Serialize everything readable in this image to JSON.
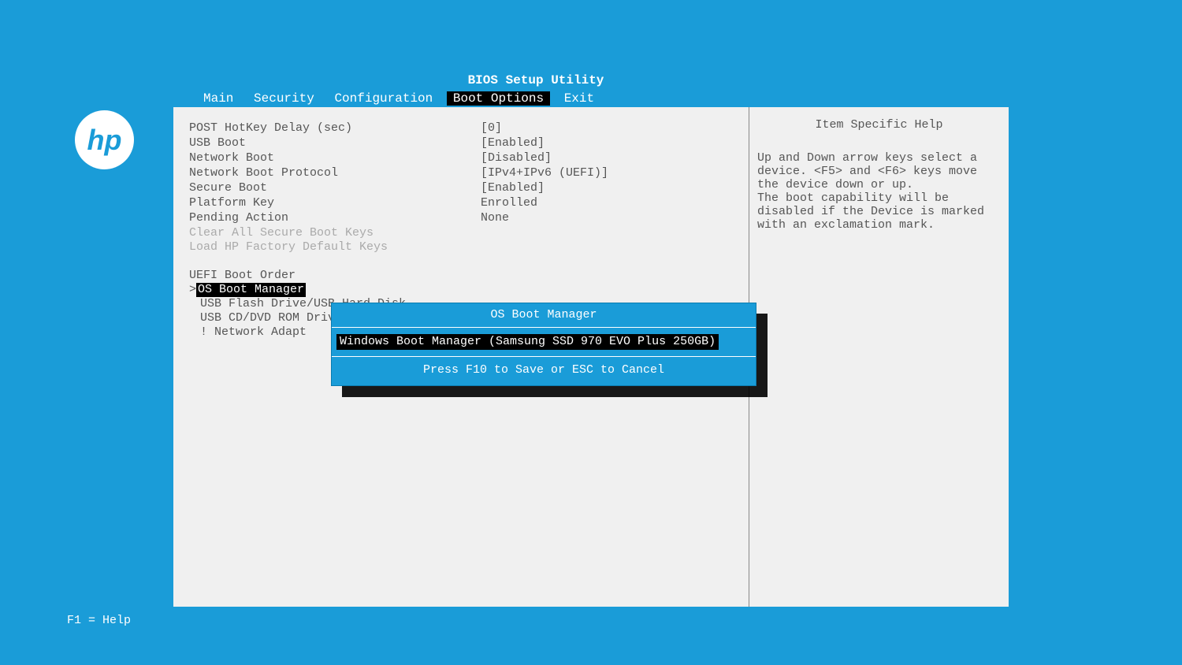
{
  "title": "BIOS Setup Utility",
  "menu": {
    "items": [
      "Main",
      "Security",
      "Configuration",
      "Boot Options",
      "Exit"
    ],
    "active_index": 3
  },
  "logo_text": "hp",
  "settings": [
    {
      "label": "POST HotKey Delay (sec)",
      "value": "[0]"
    },
    {
      "label": "USB Boot",
      "value": "[Enabled]"
    },
    {
      "label": "Network Boot",
      "value": "[Disabled]"
    },
    {
      "label": "Network Boot Protocol",
      "value": "[IPv4+IPv6 (UEFI)]"
    },
    {
      "label": "Secure Boot",
      "value": "[Enabled]"
    },
    {
      "label": "Platform Key",
      "value": "Enrolled"
    },
    {
      "label": "Pending Action",
      "value": "None"
    }
  ],
  "disabled_actions": [
    "Clear All Secure Boot Keys",
    "Load HP Factory Default Keys"
  ],
  "boot_order": {
    "header": "UEFI Boot Order",
    "items": [
      {
        "text": "OS Boot Manager",
        "selected": true,
        "prefix": ">"
      },
      {
        "text": "USB Flash Drive/USB Hard Disk",
        "selected": false,
        "prefix": ""
      },
      {
        "text": "USB CD/DVD ROM Drive",
        "selected": false,
        "prefix": ""
      },
      {
        "text": "! Network Adapt",
        "selected": false,
        "prefix": ""
      }
    ]
  },
  "popup": {
    "title": "OS Boot Manager",
    "selected": "Windows Boot Manager (Samsung SSD 970 EVO Plus 250GB)",
    "footer": "Press F10 to Save or ESC to Cancel"
  },
  "help": {
    "title": "Item Specific Help",
    "body": "Up and Down arrow keys select a device. <F5> and <F6> keys move the device down or up.\nThe boot capability will be disabled if the Device is marked with an exclamation mark."
  },
  "footer": "F1 = Help"
}
